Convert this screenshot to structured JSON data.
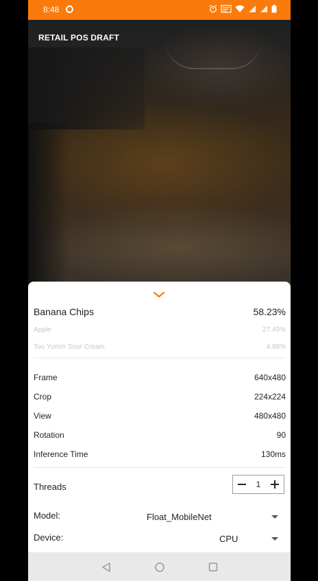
{
  "status_bar": {
    "time": "8:48",
    "icons": [
      "notification-dot-icon",
      "alarm-icon",
      "cast-icon",
      "wifi-icon",
      "signal-icon",
      "signal-icon-2",
      "battery-icon"
    ]
  },
  "app": {
    "title": "RETAIL POS DRAFT"
  },
  "results": [
    {
      "label": "Banana Chips",
      "score": "58.23%"
    },
    {
      "label": "Apple",
      "score": "27.49%"
    },
    {
      "label": "Too Yumm Sour Cream",
      "score": "4.88%"
    }
  ],
  "info": [
    {
      "label": "Frame",
      "value": "640x480"
    },
    {
      "label": "Crop",
      "value": "224x224"
    },
    {
      "label": "View",
      "value": "480x480"
    },
    {
      "label": "Rotation",
      "value": "90"
    },
    {
      "label": "Inference Time",
      "value": "130ms"
    }
  ],
  "threads": {
    "label": "Threads",
    "value": "1"
  },
  "model": {
    "label": "Model:",
    "value": "Float_MobileNet"
  },
  "device": {
    "label": "Device:",
    "value": "CPU"
  },
  "colors": {
    "status_bar": "#fb7a0c",
    "sheet": "#ffffff",
    "navbar": "#e9e9e9"
  }
}
